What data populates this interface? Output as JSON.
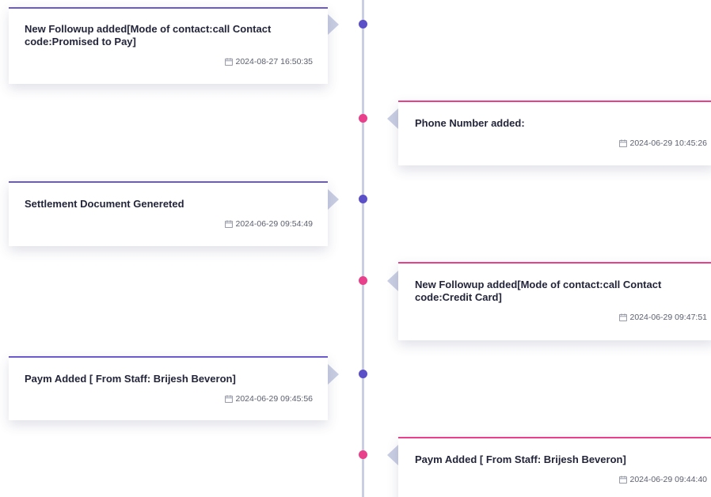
{
  "colors": {
    "left_accent": "#6a5acd",
    "right_accent": "#e8408a",
    "axis": "#c9cee3",
    "dot_left": "#5b50c8",
    "dot_right": "#e8408a"
  },
  "timeline": {
    "entries": [
      {
        "side": "left",
        "title": "New Followup added[Mode of contact:call Contact code:Promised to Pay]",
        "date": "2024-08-27 16:50:35",
        "icon": "calendar-icon"
      },
      {
        "side": "right",
        "title": "Phone Number added:",
        "date": "2024-06-29 10:45:26",
        "icon": "calendar-icon"
      },
      {
        "side": "left",
        "title": "Settlement Document Genereted",
        "date": "2024-06-29 09:54:49",
        "icon": "calendar-icon"
      },
      {
        "side": "right",
        "title": "New Followup added[Mode of contact:call Contact code:Credit Card]",
        "date": "2024-06-29 09:47:51",
        "icon": "calendar-icon"
      },
      {
        "side": "left",
        "title": "Paym Added [ From Staff: Brijesh Beveron]",
        "date": "2024-06-29 09:45:56",
        "icon": "calendar-icon"
      },
      {
        "side": "right",
        "title": "Paym Added [ From Staff: Brijesh Beveron]",
        "date": "2024-06-29 09:44:40",
        "icon": "calendar-icon"
      }
    ]
  }
}
